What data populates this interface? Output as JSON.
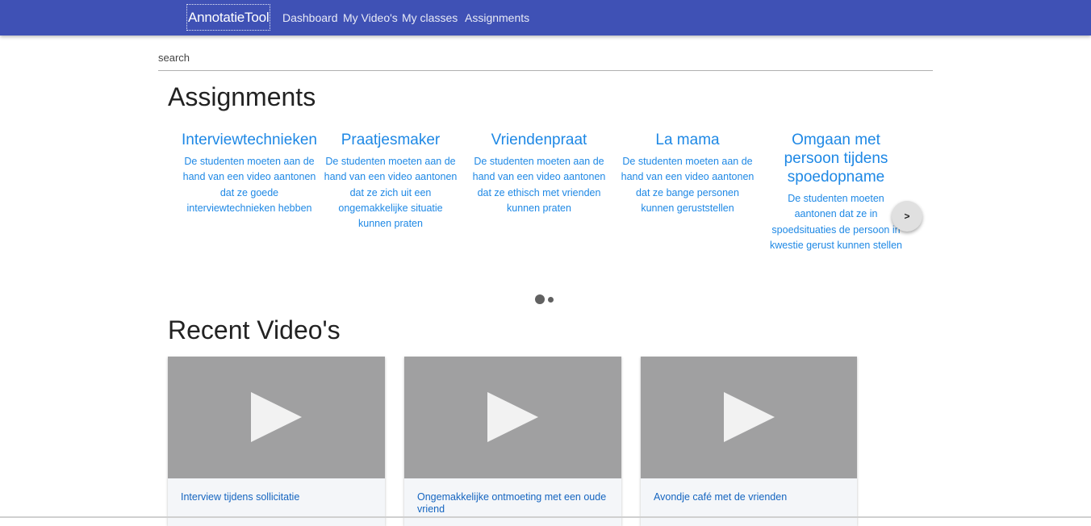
{
  "nav": {
    "brand": "AnnotatieTool",
    "links": [
      "Dashboard",
      "My Video's",
      "My classes",
      "Assignments"
    ]
  },
  "search": {
    "placeholder": "search",
    "value": ""
  },
  "assignments": {
    "heading": "Assignments",
    "items": [
      {
        "title": "Interviewtechnieken",
        "description": "De studenten moeten aan de hand van een video aantonen dat ze goede interviewtechnieken hebben"
      },
      {
        "title": "Praatjesmaker",
        "description": "De studenten moeten aan de hand van een video aantonen dat ze zich uit een ongemakkelijke situatie kunnen praten"
      },
      {
        "title": "Vriendenpraat",
        "description": "De studenten moeten aan de hand van een video aantonen dat ze ethisch met vrienden kunnen praten"
      },
      {
        "title": "La mama",
        "description": "De studenten moeten aan de hand van een video aantonen dat ze bange personen kunnen geruststellen"
      },
      {
        "title": "Omgaan met persoon tijdens spoedopname",
        "description": "De studenten moeten aantonen dat ze in spoedsituaties de persoon in kwestie gerust kunnen stellen"
      }
    ],
    "next_label": ">",
    "pages": 2,
    "active_page": 1
  },
  "recent_videos": {
    "heading": "Recent Video's",
    "items": [
      {
        "title": "Interview tijdens sollicitatie"
      },
      {
        "title": "Ongemakkelijke ontmoeting met een oude vriend"
      },
      {
        "title": "Avondje café met de vrienden"
      }
    ]
  },
  "colors": {
    "navbar": "#3f51b5",
    "link": "#1e88e5",
    "video_title": "#1565c0",
    "thumbnail": "#a0a0a1"
  },
  "icons": {
    "play": "play-icon",
    "next": "chevron-right-icon"
  }
}
